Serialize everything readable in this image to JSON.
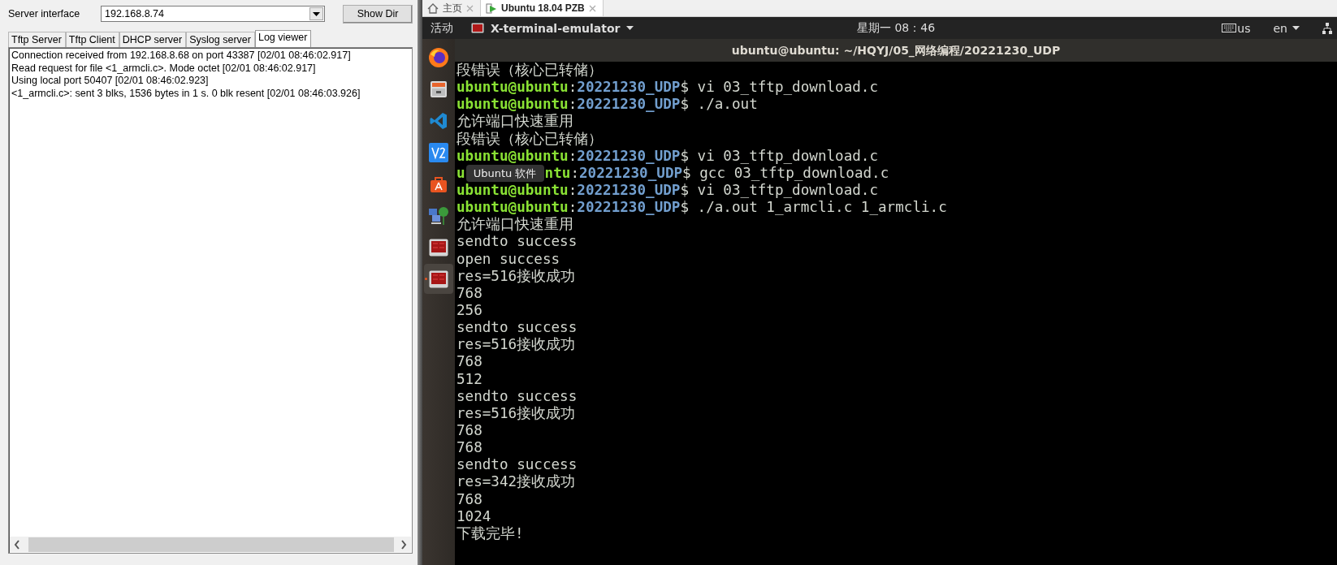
{
  "tftp": {
    "interface_label": "Server interface",
    "interface": "192.168.8.74",
    "show_dir": "Show Dir",
    "tabs": [
      {
        "label": "Tftp Server",
        "selected": false
      },
      {
        "label": "Tftp Client",
        "selected": false
      },
      {
        "label": "DHCP server",
        "selected": false
      },
      {
        "label": "Syslog server",
        "selected": false
      },
      {
        "label": "Log viewer",
        "selected": true
      }
    ],
    "log": [
      "Connection received from 192.168.8.68 on port 43387 [02/01 08:46:02.917]",
      "Read request for file <1_armcli.c>. Mode octet [02/01 08:46:02.917]",
      "Using local port 50407 [02/01 08:46:02.923]",
      "<1_armcli.c>: sent 3 blks, 1536 bytes in 1 s. 0 blk resent [02/01 08:46:03.926]"
    ]
  },
  "vm": {
    "tabs": [
      {
        "label": "主页",
        "kind": "home",
        "selected": false
      },
      {
        "label": "Ubuntu 18.04 PZB",
        "kind": "vm",
        "selected": true
      }
    ],
    "top_bar": {
      "activities": "活动",
      "app": "X-terminal-emulator",
      "clock": "星期一 08：46",
      "keyboard": "us",
      "language": "en"
    },
    "dock": [
      {
        "kind": "firefox",
        "selected": false
      },
      {
        "kind": "files",
        "selected": false
      },
      {
        "kind": "vscode",
        "selected": false
      },
      {
        "kind": "v2",
        "selected": false
      },
      {
        "kind": "software",
        "selected": false
      },
      {
        "kind": "network",
        "selected": false
      },
      {
        "kind": "terminal",
        "selected": false
      },
      {
        "kind": "terminal",
        "selected": true
      }
    ],
    "terminal": {
      "title": "ubuntu@ubuntu: ~/HQYJ/05_网络编程/20221230_UDP",
      "lines": [
        {
          "kind": "text",
          "text": "段错误（核心已转储）"
        },
        {
          "kind": "prompt",
          "user": "ubuntu@ubuntu",
          "sep": ":",
          "path": "20221230_UDP",
          "command": "$ vi 03_tftp_download.c"
        },
        {
          "kind": "prompt",
          "user": "ubuntu@ubuntu",
          "sep": ":",
          "path": "20221230_UDP",
          "command": "$ ./a.out"
        },
        {
          "kind": "text",
          "text": "允许端口快速重用"
        },
        {
          "kind": "text",
          "text": "段错误（核心已转储）"
        },
        {
          "kind": "prompt",
          "user": "ubuntu@ubuntu",
          "sep": ":",
          "path": "20221230_UDP",
          "command": "$ vi 03_tftp_download.c"
        },
        {
          "kind": "covered",
          "user": "u",
          "tooltip": "Ubuntu 软件",
          "user_rest": "ntu",
          "sep": ":",
          "path": "20221230_UDP",
          "command": "$ gcc 03_tftp_download.c"
        },
        {
          "kind": "prompt",
          "user": "ubuntu@ubuntu",
          "sep": ":",
          "path": "20221230_UDP",
          "command": "$ vi 03_tftp_download.c"
        },
        {
          "kind": "prompt",
          "user": "ubuntu@ubuntu",
          "sep": ":",
          "path": "20221230_UDP",
          "command": "$ ./a.out 1_armcli.c 1_armcli.c"
        },
        {
          "kind": "text",
          "text": "允许端口快速重用"
        },
        {
          "kind": "text",
          "text": "sendto success"
        },
        {
          "kind": "text",
          "text": "open success"
        },
        {
          "kind": "text",
          "text": "res=516接收成功"
        },
        {
          "kind": "text",
          "text": "768"
        },
        {
          "kind": "text",
          "text": "256"
        },
        {
          "kind": "text",
          "text": "sendto success"
        },
        {
          "kind": "text",
          "text": "res=516接收成功"
        },
        {
          "kind": "text",
          "text": "768"
        },
        {
          "kind": "text",
          "text": "512"
        },
        {
          "kind": "text",
          "text": "sendto success"
        },
        {
          "kind": "text",
          "text": "res=516接收成功"
        },
        {
          "kind": "text",
          "text": "768"
        },
        {
          "kind": "text",
          "text": "768"
        },
        {
          "kind": "text",
          "text": "sendto success"
        },
        {
          "kind": "text",
          "text": "res=342接收成功"
        },
        {
          "kind": "text",
          "text": "768"
        },
        {
          "kind": "text",
          "text": "1024"
        },
        {
          "kind": "text",
          "text": "下载完毕!"
        }
      ]
    }
  }
}
